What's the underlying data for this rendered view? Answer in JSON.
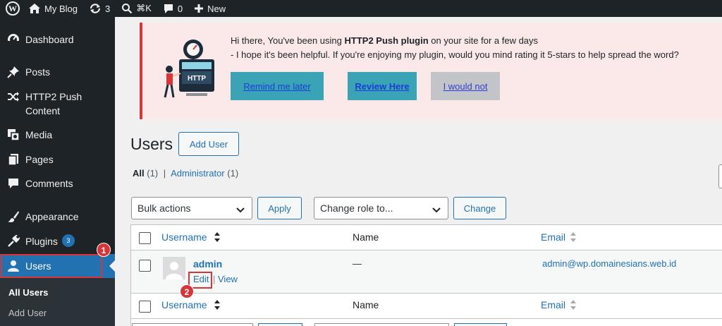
{
  "adminbar": {
    "wp_logo": "W",
    "site_name": "My Blog",
    "updates_count": "3",
    "shortcut": "⌘K",
    "comments_count": "0",
    "new_label": "New"
  },
  "sidebar": {
    "items": [
      {
        "label": "Dashboard",
        "icon": "dashboard-icon"
      },
      {
        "label": "Posts",
        "icon": "pin-icon"
      },
      {
        "label": "HTTP2 Push Content",
        "icon": "shuffle-icon"
      },
      {
        "label": "Media",
        "icon": "media-icon"
      },
      {
        "label": "Pages",
        "icon": "page-icon"
      },
      {
        "label": "Comments",
        "icon": "comment-icon"
      },
      {
        "label": "Appearance",
        "icon": "brush-icon"
      },
      {
        "label": "Plugins",
        "icon": "plugin-icon",
        "badge": "3"
      },
      {
        "label": "Users",
        "icon": "user-icon"
      }
    ],
    "submenu": [
      {
        "label": "All Users"
      },
      {
        "label": "Add User"
      }
    ]
  },
  "annotations": {
    "step1": "1",
    "step2": "2"
  },
  "notice": {
    "line1_prefix": "Hi there, You've been using ",
    "line1_bold": "HTTP2 Push plugin",
    "line1_suffix": " on your site for a few days",
    "line2": "- I hope it's been helpful. If you're enjoying my plugin, would you mind rating it 5-stars to help spread the word?",
    "remind_label": "Remind me later",
    "review_label": "Review Here",
    "not_label": "I would not",
    "illustration_text": "HTTP"
  },
  "page": {
    "title": "Users",
    "add_user_label": "Add User",
    "filter_all": "All",
    "filter_all_count": "(1)",
    "filter_sep": "|",
    "filter_admin": "Administrator",
    "filter_admin_count": "(1)"
  },
  "toolbar": {
    "bulk_actions": "Bulk actions",
    "apply_label": "Apply",
    "change_role": "Change role to...",
    "change_label": "Change"
  },
  "table": {
    "columns": {
      "username": "Username",
      "name": "Name",
      "email": "Email"
    },
    "rows": [
      {
        "username": "admin",
        "name": "—",
        "email": "admin@wp.domainesians.web.id",
        "edit": "Edit",
        "sep": "|",
        "view": "View"
      }
    ]
  },
  "colors": {
    "admin_bar": "#1d2327",
    "accent": "#2271b1",
    "notice_bg": "#fbe9e9",
    "notice_border": "#d63638",
    "annotation": "#d63638",
    "teal_button": "#3aa3b6"
  }
}
